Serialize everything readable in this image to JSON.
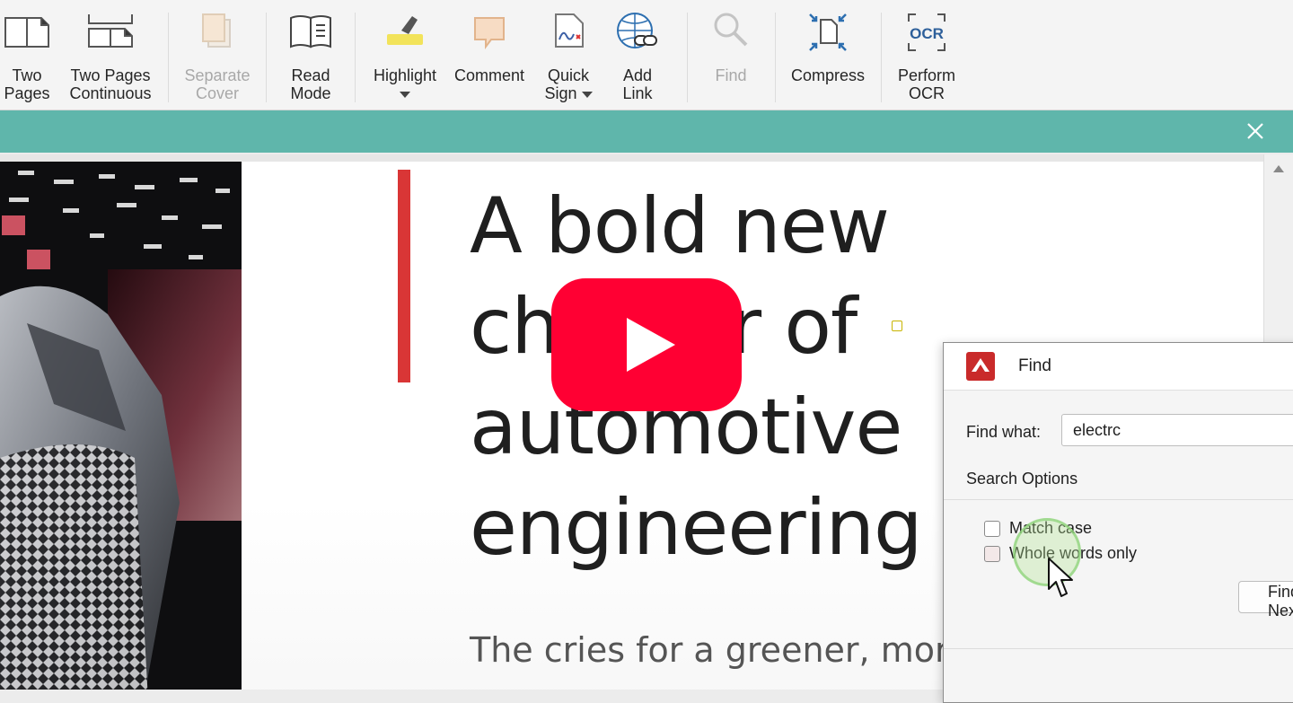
{
  "toolbar": {
    "two_pages": "Two\nPages",
    "two_pages_continuous": "Two Pages\nContinuous",
    "separate_cover": "Separate\nCover",
    "read_mode": "Read\nMode",
    "highlight": "Highlight",
    "comment": "Comment",
    "quick_sign": "Quick\nSign",
    "add_link": "Add\nLink",
    "find": "Find",
    "compress": "Compress",
    "perform_ocr": "Perform\nOCR",
    "ocr_icon_text": "OCR"
  },
  "banner": {
    "close_icon": "close-icon"
  },
  "document": {
    "headline": "A bold new\nchapter of\nautomotive\nengineering",
    "subline": "The cries for a greener, more"
  },
  "find_dialog": {
    "title": "Find",
    "find_what_label": "Find what:",
    "find_what_value": "electrc",
    "search_options_label": "Search Options",
    "match_case": "Match case",
    "whole_words_only": "Whole words only",
    "find_button": "Find Next"
  },
  "colors": {
    "banner": "#5fb6ab",
    "accent_red": "#d93636",
    "play_button": "#ff0033",
    "highlight_yellow": "#f2e35a"
  }
}
